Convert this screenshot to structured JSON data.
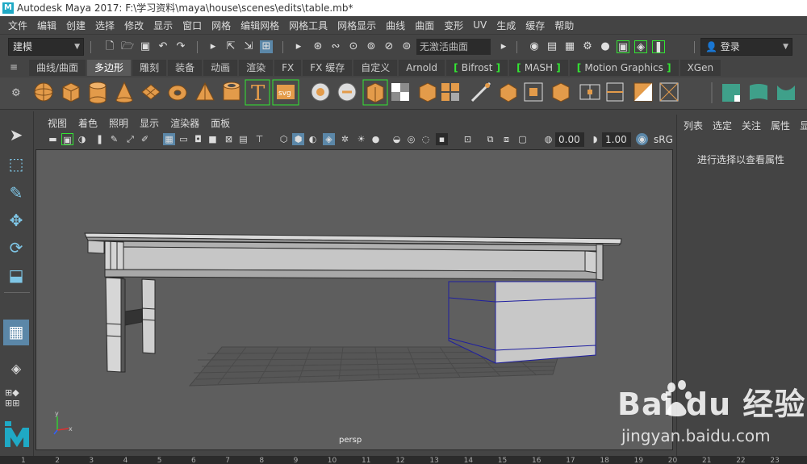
{
  "title_bar": {
    "logo": "M",
    "title": "Autodesk Maya 2017: F:\\学习资料\\maya\\house\\scenes\\edits\\table.mb*"
  },
  "menu": [
    "文件",
    "编辑",
    "创建",
    "选择",
    "修改",
    "显示",
    "窗口",
    "网格",
    "编辑网格",
    "网格工具",
    "网格显示",
    "曲线",
    "曲面",
    "变形",
    "UV",
    "生成",
    "缓存",
    "帮助"
  ],
  "status_line": {
    "mode_dropdown": "建模",
    "live_surface": "无激活曲面",
    "login": "登录"
  },
  "shelf_tabs": [
    {
      "label": "曲线/曲面",
      "bracket": false
    },
    {
      "label": "多边形",
      "bracket": false,
      "active": true
    },
    {
      "label": "雕刻",
      "bracket": false
    },
    {
      "label": "装备",
      "bracket": false
    },
    {
      "label": "动画",
      "bracket": false
    },
    {
      "label": "渲染",
      "bracket": false
    },
    {
      "label": "FX",
      "bracket": false
    },
    {
      "label": "FX 缓存",
      "bracket": false
    },
    {
      "label": "自定义",
      "bracket": false
    },
    {
      "label": "Arnold",
      "bracket": false
    },
    {
      "label": "Bifrost",
      "bracket": true
    },
    {
      "label": "MASH",
      "bracket": true
    },
    {
      "label": "Motion Graphics",
      "bracket": true
    },
    {
      "label": "XGen",
      "bracket": false
    }
  ],
  "shelf_icons": [
    "sphere-icon",
    "cube-icon",
    "cylinder-icon",
    "cone-icon",
    "plane-icon",
    "torus-icon",
    "pyramid-icon",
    "pipe-icon",
    "type-icon",
    "svg-icon",
    "combine-icon",
    "separate-icon",
    "mash-icon",
    "smooth-icon",
    "extract-icon",
    "boolean-icon",
    "mirror-icon",
    "extrude-icon",
    "bridge-icon",
    "bevel-icon",
    "multicut-icon",
    "target-weld-icon",
    "connect-icon",
    "fill-hole-icon",
    "uv-planar-icon",
    "uv-auto-icon",
    "uv-editor-icon"
  ],
  "shelf_type_label": "T",
  "shelf_svg_label": "svg",
  "viewport_menu": [
    "视图",
    "着色",
    "照明",
    "显示",
    "渲染器",
    "面板"
  ],
  "viewport_toolbar": {
    "exposure": "0.00",
    "gamma": "1.00",
    "color_space": "sRG"
  },
  "viewport_label": "persp",
  "right_panel": {
    "tabs": [
      "列表",
      "选定",
      "关注",
      "属性",
      "显"
    ],
    "message": "进行选择以查看属性"
  },
  "timeline_ticks": [
    "1",
    "2",
    "3",
    "4",
    "5",
    "6",
    "7",
    "8",
    "9",
    "10",
    "11",
    "12",
    "13",
    "14",
    "15",
    "16",
    "17",
    "18",
    "19",
    "20",
    "21",
    "22",
    "23"
  ],
  "watermark": {
    "brand": "Bai du 经验",
    "url": "jingyan.baidu.com"
  },
  "colors": {
    "shelf_icon_orange": "#e39b4a",
    "highlight_green": "#33e633",
    "viewport_bg": "#5e5e5e",
    "selection_blue": "#1f1fa0"
  }
}
